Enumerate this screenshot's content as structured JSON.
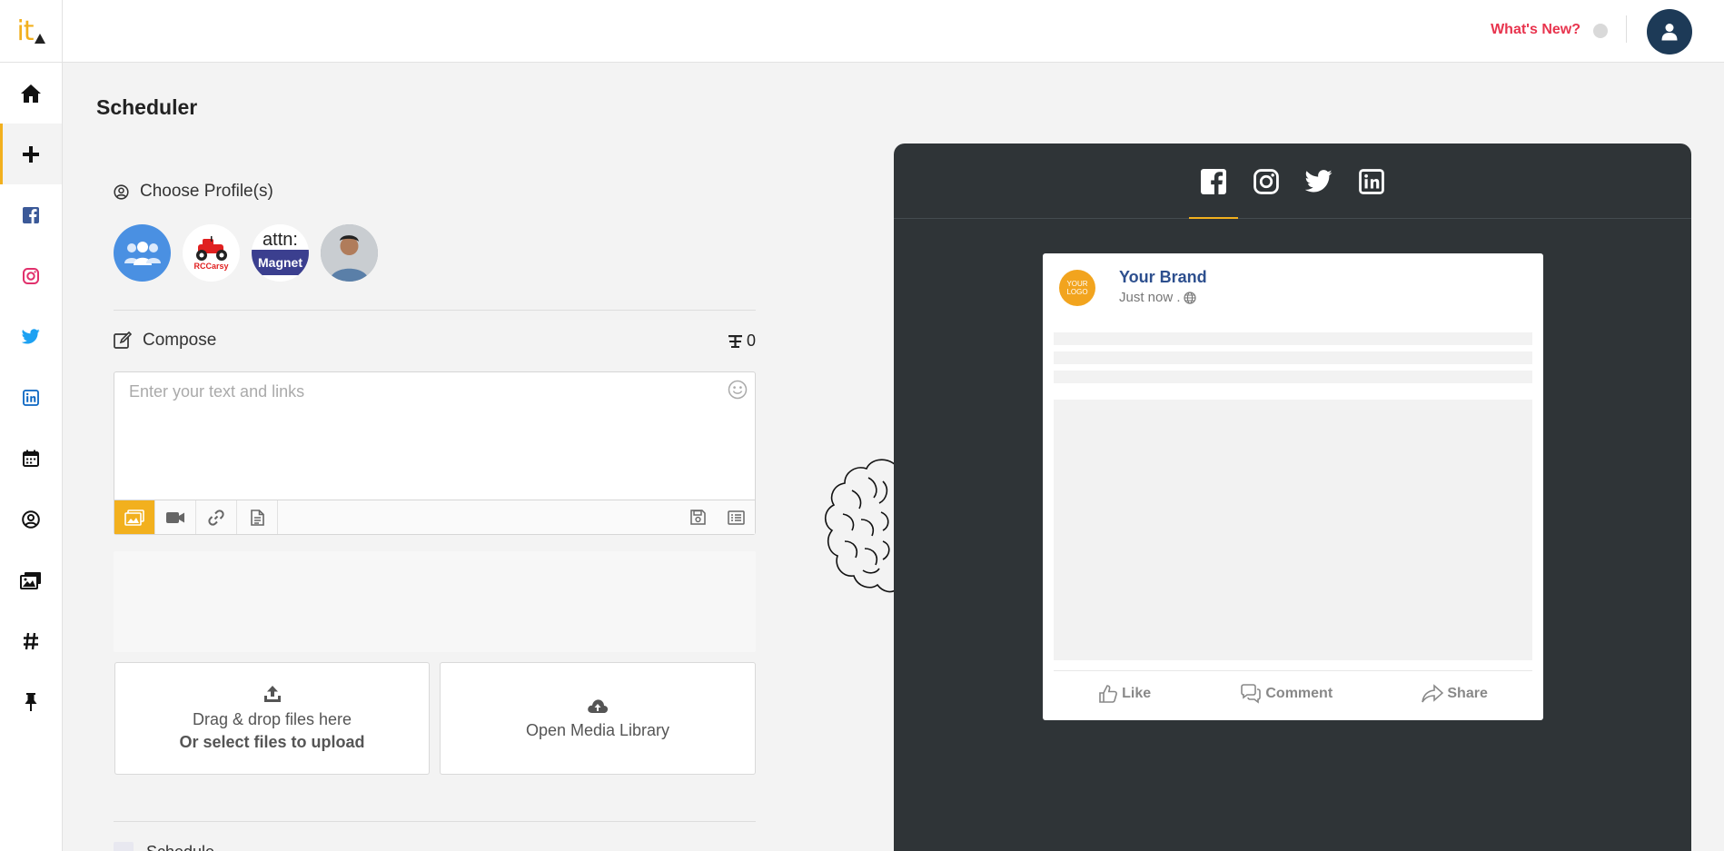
{
  "app": {
    "logo_text": "it"
  },
  "topbar": {
    "whats_new": "What's New?"
  },
  "sidebar": {
    "items": [
      {
        "name": "home-icon"
      },
      {
        "name": "plus-icon",
        "active": true
      },
      {
        "name": "facebook-icon"
      },
      {
        "name": "instagram-icon"
      },
      {
        "name": "twitter-icon"
      },
      {
        "name": "linkedin-icon"
      },
      {
        "name": "calendar-icon"
      },
      {
        "name": "user-circle-icon"
      },
      {
        "name": "media-icon"
      },
      {
        "name": "hashtag-icon"
      },
      {
        "name": "pin-icon"
      }
    ]
  },
  "main": {
    "title": "Scheduler",
    "choose_profiles": "Choose Profile(s)",
    "profiles": [
      {
        "name": "group-profile",
        "text": ""
      },
      {
        "name": "rccarsy-profile",
        "text": "RCCarsy"
      },
      {
        "name": "attn-profile",
        "text_top": "attn:",
        "text_bottom": "Magnet"
      },
      {
        "name": "person-profile",
        "text": ""
      }
    ],
    "compose": {
      "label": "Compose",
      "char_count": "0",
      "placeholder": "Enter your text and links"
    },
    "upload": {
      "line1": "Drag & drop files here",
      "line2": "Or select files to upload"
    },
    "media_library": "Open Media Library",
    "schedule_label": "Schedule"
  },
  "preview": {
    "networks": [
      "facebook",
      "instagram",
      "twitter",
      "linkedin"
    ],
    "active_network": "facebook",
    "brand_logo_top": "YOUR",
    "brand_logo_bottom": "LOGO",
    "brand_name": "Your Brand",
    "post_time": "Just now .",
    "actions": {
      "like": "Like",
      "comment": "Comment",
      "share": "Share"
    }
  },
  "colors": {
    "accent": "#f2b01e",
    "panel_bg": "#2f3437",
    "whats_new": "#e8344e",
    "brand_blue": "#2d4f8e",
    "avatar_bg": "#1d3a57"
  }
}
